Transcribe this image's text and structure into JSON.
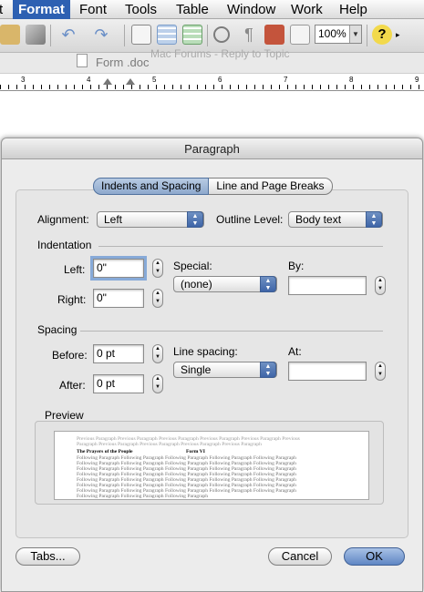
{
  "menubar": {
    "items": [
      {
        "label": "t"
      },
      {
        "label": "Format",
        "active": true
      },
      {
        "label": "Font"
      },
      {
        "label": "Tools"
      },
      {
        "label": "Table"
      },
      {
        "label": "Window"
      },
      {
        "label": "Work"
      },
      {
        "label": "Help"
      }
    ]
  },
  "toolbar": {
    "zoom": "100%"
  },
  "document": {
    "title": "Form .doc",
    "background_text": "Mac Forums - Reply to Topic"
  },
  "ruler": {
    "numbers": [
      "3",
      "4",
      "5",
      "6",
      "7",
      "8",
      "9"
    ]
  },
  "dialog": {
    "title": "Paragraph",
    "tabs": [
      {
        "label": "Indents and Spacing",
        "selected": true
      },
      {
        "label": "Line and Page Breaks",
        "selected": false
      }
    ],
    "alignment": {
      "label": "Alignment:",
      "value": "Left"
    },
    "outline_level": {
      "label": "Outline Level:",
      "value": "Body text"
    },
    "indentation": {
      "heading": "Indentation",
      "left_label": "Left:",
      "left_value": "0\"",
      "right_label": "Right:",
      "right_value": "0\"",
      "special_label": "Special:",
      "special_value": "(none)",
      "by_label": "By:",
      "by_value": ""
    },
    "spacing": {
      "heading": "Spacing",
      "before_label": "Before:",
      "before_value": "0 pt",
      "after_label": "After:",
      "after_value": "0 pt",
      "line_spacing_label": "Line spacing:",
      "line_spacing_value": "Single",
      "at_label": "At:",
      "at_value": ""
    },
    "preview": {
      "heading": "Preview",
      "previous_text": "Previous Paragraph Previous Paragraph Previous Paragraph Previous Paragraph Previous Paragraph Previous",
      "previous_text_2": "Paragraph Previous Paragraph Previous Paragraph Previous Paragraph Previous Paragraph",
      "sample_left": "The Prayers of the People",
      "sample_right": "Form VI",
      "following_text": "Following Paragraph Following Paragraph Following Paragraph Following Paragraph Following Paragraph",
      "following_last": "Following Paragraph Following Paragraph Following Paragraph"
    },
    "buttons": {
      "tabs": "Tabs...",
      "cancel": "Cancel",
      "ok": "OK"
    }
  },
  "colors": {
    "menu_highlight": "#2d60b2",
    "popup_arrows": "#4a6fae",
    "focus_ring": "#87aad8"
  }
}
